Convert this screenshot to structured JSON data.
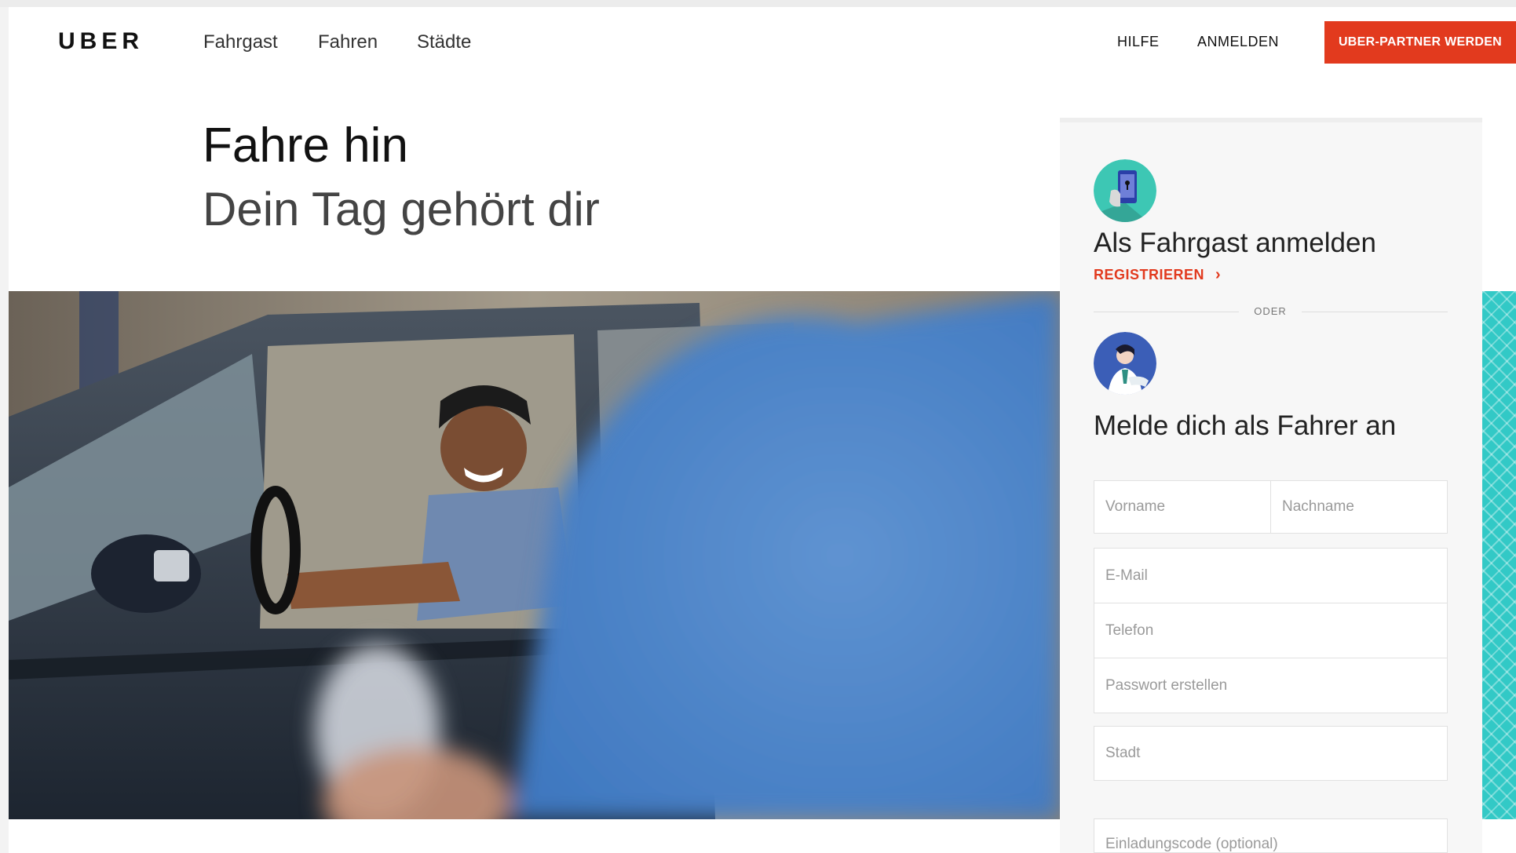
{
  "header": {
    "logo": "UBER",
    "nav": [
      "Fahrgast",
      "Fahren",
      "Städte"
    ],
    "help": "HILFE",
    "login": "ANMELDEN",
    "partner_button": "UBER-PARTNER WERDEN"
  },
  "hero": {
    "title": "Fahre hin",
    "subtitle": "Dein Tag gehört dir"
  },
  "rider": {
    "icon": "phone-icon",
    "heading": "Als Fahrgast anmelden",
    "register": "REGISTRIEREN",
    "chevron": "›"
  },
  "divider": "ODER",
  "driver": {
    "icon": "driver-icon",
    "heading": "Melde dich als Fahrer an"
  },
  "form": {
    "first_name": "Vorname",
    "last_name": "Nachname",
    "email": "E-Mail",
    "phone": "Telefon",
    "password": "Passwort erstellen",
    "city": "Stadt",
    "invite_code": "Einladungscode (optional)"
  },
  "colors": {
    "accent": "#e23a1e",
    "teal": "#32c9c6",
    "card_bg": "#f7f7f7"
  }
}
